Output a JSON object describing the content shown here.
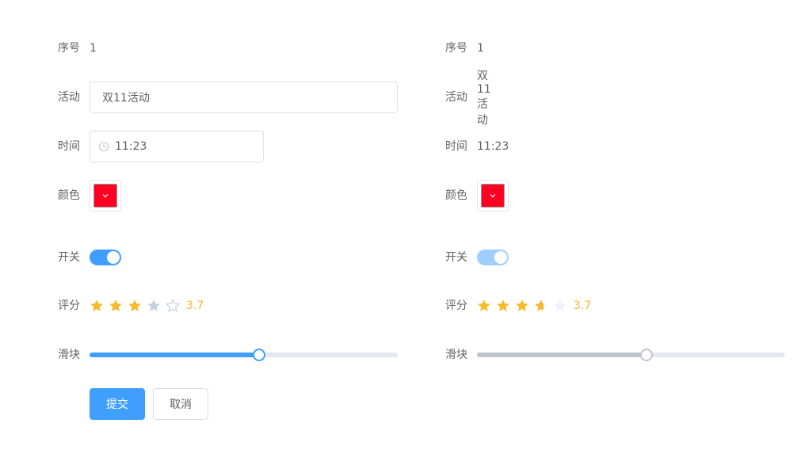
{
  "colors": {
    "primary": "#409eff",
    "switch_off_disabled": "#a0cfff",
    "star_on": "#f7ba2a",
    "star_off": "#c6d1de",
    "star_off_disabled": "#eff2f7",
    "picked_color": "#ff0022",
    "slider_disabled": "#c0c4cc"
  },
  "edit_form": {
    "index": {
      "label": "序号",
      "value": "1"
    },
    "activity": {
      "label": "活动",
      "value": "双11活动"
    },
    "time": {
      "label": "时间",
      "value": "11:23",
      "icon": "clock-icon"
    },
    "color": {
      "label": "颜色",
      "value": "#ff0022",
      "icon": "chevron-down-icon"
    },
    "switch": {
      "label": "开关",
      "on": true
    },
    "rate": {
      "label": "评分",
      "value": 3.7,
      "max": 5,
      "text": "3.7"
    },
    "slider": {
      "label": "滑块",
      "value": 55,
      "max": 100
    },
    "buttons": {
      "submit": "提交",
      "cancel": "取消"
    }
  },
  "view_form": {
    "index": {
      "label": "序号",
      "value": "1"
    },
    "activity": {
      "label": "活动",
      "value": "双11活动"
    },
    "time": {
      "label": "时间",
      "value": "11:23"
    },
    "color": {
      "label": "颜色",
      "value": "#ff0022",
      "icon": "chevron-down-icon"
    },
    "switch": {
      "label": "开关",
      "on": true,
      "disabled": true
    },
    "rate": {
      "label": "评分",
      "value": 3.7,
      "max": 5,
      "text": "3.7"
    },
    "slider": {
      "label": "滑块",
      "value": 55,
      "max": 100,
      "disabled": true
    }
  }
}
